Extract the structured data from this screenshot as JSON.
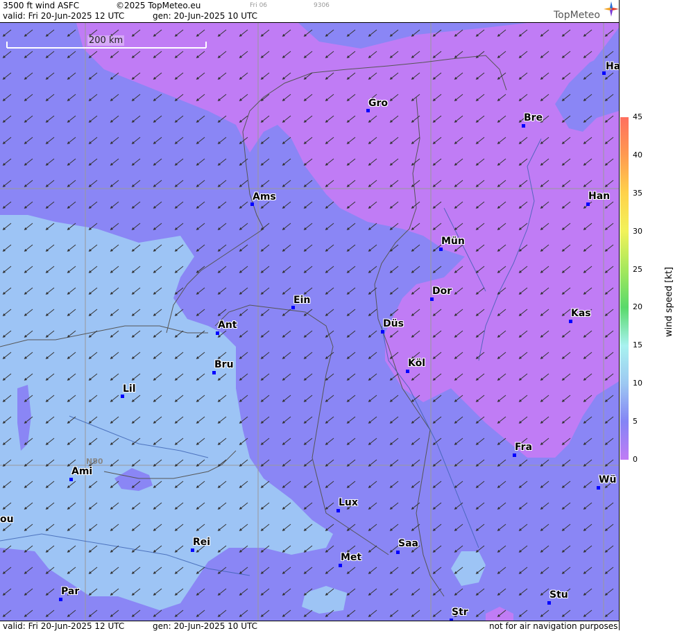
{
  "header": {
    "product": "3500 ft wind ASFC",
    "copyright": "©2025 TopMeteo.eu",
    "small_day": "Fri 06",
    "small_code": "9306",
    "valid_line": "valid:  Fri  20-Jun-2025  12 UTC",
    "gen_line": "gen: 20-Jun-2025 10 UTC"
  },
  "footer": {
    "valid_line": "valid:  Fri  20-Jun-2025  12 UTC",
    "gen_line": "gen: 20-Jun-2025 10 UTC",
    "disclaimer": "not for air navigation purposes"
  },
  "logo": {
    "text": "TopMeteo",
    "icon": "compass-star-icon"
  },
  "scale": {
    "label": "200 km"
  },
  "grid_label": "N50",
  "colorbar": {
    "title": "wind  speed  [kt]",
    "ticks": [
      "45",
      "40",
      "35",
      "30",
      "25",
      "20",
      "15",
      "10",
      "5",
      "0"
    ],
    "colors": [
      "#ff6f5f",
      "#ff9a50",
      "#ffd24a",
      "#f2f25a",
      "#a6e85c",
      "#59d96b",
      "#a8f2f0",
      "#9dc8f2",
      "#8484f5",
      "#c07cf5"
    ]
  },
  "cities": [
    {
      "name": "Ha"
    },
    {
      "name": "Gro"
    },
    {
      "name": "Bre"
    },
    {
      "name": "Ams"
    },
    {
      "name": "Han"
    },
    {
      "name": "Mün"
    },
    {
      "name": "Dor"
    },
    {
      "name": "Ein"
    },
    {
      "name": "Kas"
    },
    {
      "name": "Ant"
    },
    {
      "name": "Düs"
    },
    {
      "name": "Köl"
    },
    {
      "name": "Bru"
    },
    {
      "name": "Lil"
    },
    {
      "name": "Fra"
    },
    {
      "name": "Ami"
    },
    {
      "name": "Wü"
    },
    {
      "name": "Lux"
    },
    {
      "name": "ou"
    },
    {
      "name": "Rei"
    },
    {
      "name": "Saa"
    },
    {
      "name": "Met"
    },
    {
      "name": "Stu"
    },
    {
      "name": "Par"
    },
    {
      "name": "Str"
    }
  ]
}
